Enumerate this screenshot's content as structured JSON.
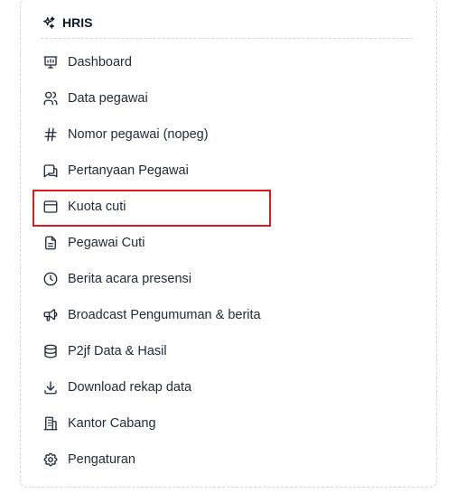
{
  "header": {
    "title": "HRIS",
    "icon": "sparkles-icon"
  },
  "menu": {
    "items": [
      {
        "label": "Dashboard",
        "icon": "presentation-chart-icon"
      },
      {
        "label": "Data pegawai",
        "icon": "users-icon"
      },
      {
        "label": "Nomor pegawai (nopeg)",
        "icon": "hash-icon"
      },
      {
        "label": "Pertanyaan Pegawai",
        "icon": "message-question-icon"
      },
      {
        "label": "Kuota cuti",
        "icon": "calendar-window-icon"
      },
      {
        "label": "Pegawai Cuti",
        "icon": "file-text-icon"
      },
      {
        "label": "Berita acara presensi",
        "icon": "clock-icon"
      },
      {
        "label": "Broadcast Pengumuman & berita",
        "icon": "megaphone-icon"
      },
      {
        "label": "P2jf Data & Hasil",
        "icon": "database-icon"
      },
      {
        "label": "Download rekap data",
        "icon": "download-icon"
      },
      {
        "label": "Kantor Cabang",
        "icon": "building-icon"
      },
      {
        "label": "Pengaturan",
        "icon": "gear-icon"
      }
    ]
  },
  "highlight": {
    "target": "Kuota cuti",
    "color": "#e0191e"
  }
}
